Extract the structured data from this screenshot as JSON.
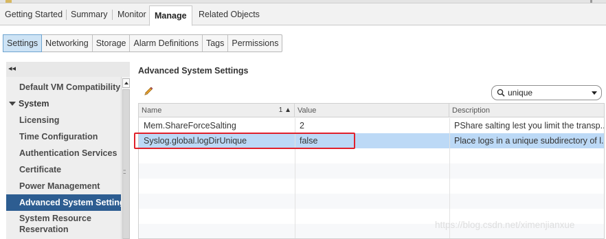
{
  "tabs": {
    "items": [
      {
        "label": "Getting Started"
      },
      {
        "label": "Summary"
      },
      {
        "label": "Monitor"
      },
      {
        "label": "Manage",
        "active": true
      },
      {
        "label": "Related Objects"
      }
    ]
  },
  "subtabs": {
    "items": [
      {
        "label": "Settings",
        "active": true
      },
      {
        "label": "Networking"
      },
      {
        "label": "Storage"
      },
      {
        "label": "Alarm Definitions"
      },
      {
        "label": "Tags"
      },
      {
        "label": "Permissions"
      }
    ]
  },
  "sidebar": {
    "collapse_glyph": "◂◂",
    "items": [
      {
        "label": "Default VM Compatibility"
      },
      {
        "label": "System",
        "expanded": true
      },
      {
        "label": "Licensing"
      },
      {
        "label": "Time Configuration"
      },
      {
        "label": "Authentication Services"
      },
      {
        "label": "Certificate"
      },
      {
        "label": "Power Management"
      },
      {
        "label": "Advanced System Settings",
        "selected": true
      },
      {
        "label": "System Resource\nReservation"
      }
    ]
  },
  "main": {
    "title": "Advanced System Settings",
    "edit_icon": "pencil-icon",
    "search": {
      "value": "unique",
      "icon": "search-icon"
    },
    "grid": {
      "columns": [
        "Name",
        "Value",
        "Description"
      ],
      "sort_indicator": "1 ▲",
      "rows": [
        {
          "name": "Mem.ShareForceSalting",
          "value": "2",
          "description": "PShare salting lest you limit the transp..."
        },
        {
          "name": "Syslog.global.logDirUnique",
          "value": "false",
          "description": "Place logs in a unique subdirectory of l...",
          "selected": true
        }
      ]
    }
  },
  "watermark": "https://blog.csdn.net/ximenjianxue",
  "colors": {
    "selection": "#bcd9f6",
    "sidebar_selected": "#2d5d91",
    "highlight": "#e0202a"
  }
}
